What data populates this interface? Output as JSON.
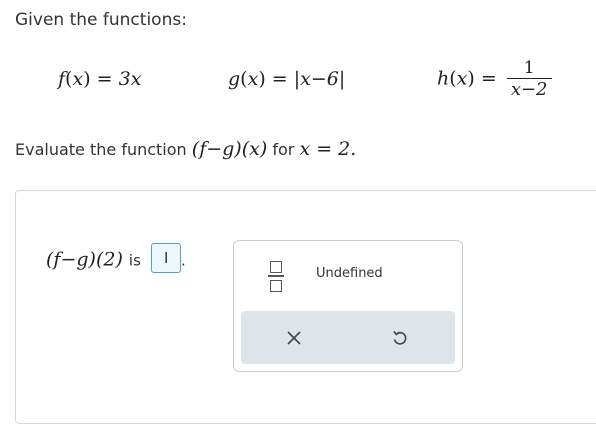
{
  "question": {
    "instruction": "Given the functions:",
    "functions": {
      "f": {
        "name": "f",
        "arg": "x",
        "rhs": "3x"
      },
      "g": {
        "name": "g",
        "arg": "x",
        "inner": "x−6"
      },
      "h": {
        "name": "h",
        "arg": "x",
        "numerator": "1",
        "denominator": "x−2"
      }
    },
    "evaluate_prefix": "Evaluate the function",
    "evaluate_expr": "(f−g)(x)",
    "evaluate_for": "for",
    "evaluate_condition": "x = 2."
  },
  "answer": {
    "expression": "(f−g)(2)",
    "is_label": "is",
    "period": ".",
    "value": ""
  },
  "keypad": {
    "undefined_label": "Undefined"
  },
  "icons": {
    "fraction": "fraction-template-icon",
    "clear": "x-close-icon",
    "undo": "undo-arrow-icon",
    "accent": "#4da3cf"
  }
}
